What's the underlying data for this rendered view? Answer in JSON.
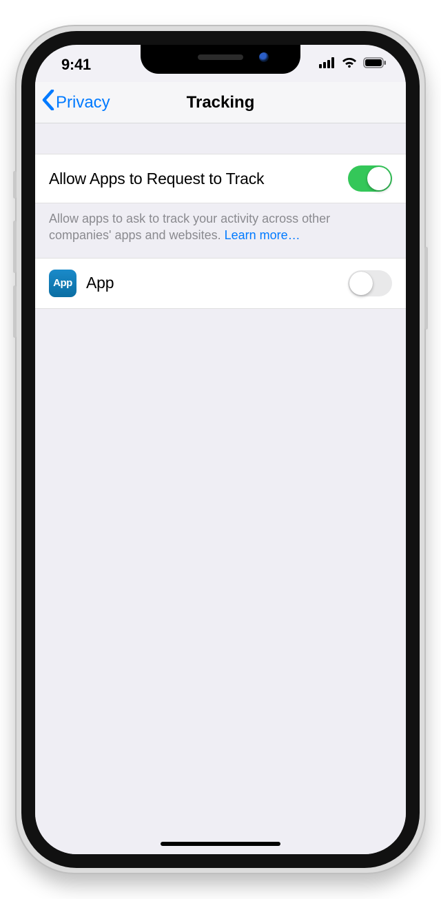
{
  "status_bar": {
    "time": "9:41"
  },
  "nav": {
    "back_label": "Privacy",
    "title": "Tracking"
  },
  "settings": {
    "allow_row": {
      "title": "Allow Apps to Request to Track",
      "on": true
    },
    "footer": {
      "text": "Allow apps to ask to track your activity across other companies' apps and websites. ",
      "link_label": "Learn more…"
    },
    "apps": [
      {
        "icon_label": "App",
        "name": "App",
        "on": false
      }
    ]
  }
}
